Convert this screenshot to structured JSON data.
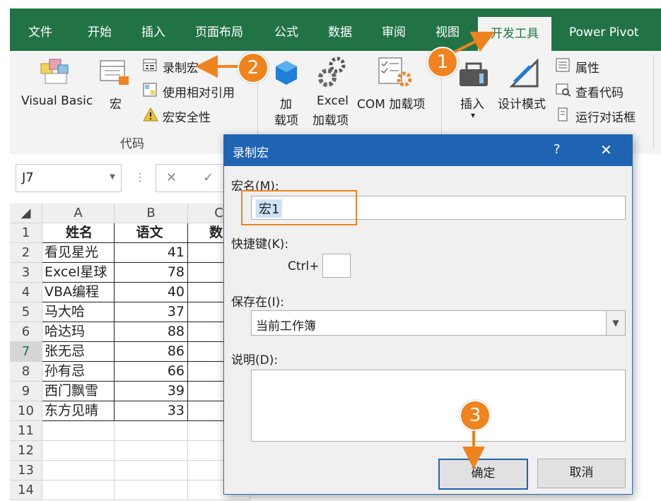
{
  "tabs": [
    "文件",
    "开始",
    "插入",
    "页面布局",
    "公式",
    "数据",
    "审阅",
    "视图",
    "开发工具",
    "Power Pivot"
  ],
  "ribbon": {
    "visual_basic": "Visual Basic",
    "macros": "宏",
    "record_macro": "录制宏",
    "relative_ref": "使用相对引用",
    "macro_security": "宏安全性",
    "group_code": "代码",
    "addins_1": "加",
    "addins_2": "载项",
    "excel_addins_1": "Excel",
    "excel_addins_2": "加载项",
    "com_addins": "COM 加载项",
    "insert": "插入",
    "insert_arrow": "▾",
    "design_mode": "设计模式",
    "properties": "属性",
    "view_code": "查看代码",
    "run_dialog": "运行对话框"
  },
  "formula_bar": {
    "name_box": "J7",
    "cancel": "✕",
    "enter": "✓"
  },
  "sheet": {
    "columns": [
      "A",
      "B",
      "C"
    ],
    "rows": [
      "1",
      "2",
      "3",
      "4",
      "5",
      "6",
      "7",
      "8",
      "9",
      "10",
      "11",
      "12",
      "13",
      "14"
    ],
    "header": [
      "姓名",
      "语文",
      "数"
    ],
    "data": [
      [
        "看见星光",
        "41"
      ],
      [
        "Excel星球",
        "78"
      ],
      [
        "VBA编程",
        "40"
      ],
      [
        "马大哈",
        "37"
      ],
      [
        "哈达玛",
        "88"
      ],
      [
        "张无忌",
        "86"
      ],
      [
        "孙有忌",
        "66"
      ],
      [
        "西门飘雪",
        "39"
      ],
      [
        "东方见晴",
        "33"
      ]
    ]
  },
  "dialog": {
    "title": "录制宏",
    "help": "?",
    "close": "✕",
    "macro_name_label": "宏名(M):",
    "macro_name_value": "宏1",
    "shortcut_label": "快捷键(K):",
    "ctrl_label": "Ctrl+",
    "shortcut_value": "",
    "store_label": "保存在(I):",
    "store_value": "当前工作簿",
    "desc_label": "说明(D):",
    "desc_value": "",
    "ok": "确定",
    "cancel": "取消"
  },
  "callouts": [
    "1",
    "2",
    "3"
  ],
  "colors": {
    "excel_green": "#217346",
    "dialog_blue": "#1f63b3",
    "callout_orange": "#f0831e"
  }
}
